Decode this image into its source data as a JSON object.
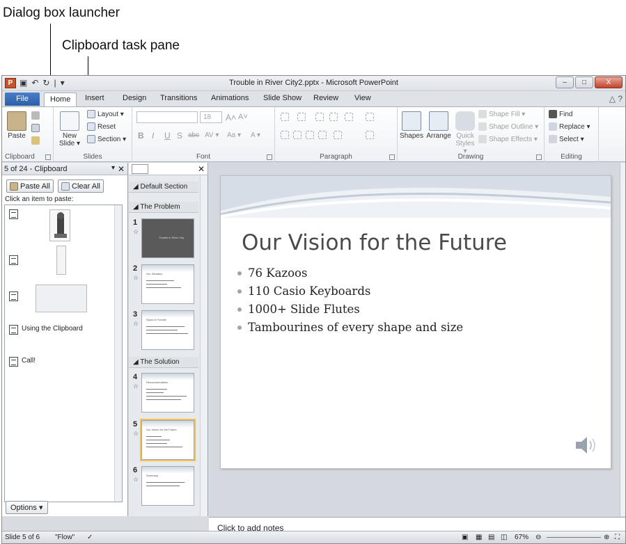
{
  "callouts": {
    "dialog_launcher": "Dialog box launcher",
    "clipboard_pane": "Clipboard task pane"
  },
  "window": {
    "title": "Trouble in River City2.pptx - Microsoft PowerPoint",
    "app_icon": "P",
    "qat": [
      "▣",
      "↶",
      "↻",
      "|",
      "▾"
    ],
    "min": "–",
    "max": "□",
    "close": "X"
  },
  "tabs": {
    "file": "File",
    "items": [
      "Home",
      "Insert",
      "Design",
      "Transitions",
      "Animations",
      "Slide Show",
      "Review",
      "View"
    ],
    "active": "Home",
    "help": "△ ?"
  },
  "ribbon": {
    "clipboard": {
      "label": "Clipboard",
      "paste": "Paste"
    },
    "slides": {
      "label": "Slides",
      "new_slide": "New",
      "new_slide_2": "Slide ▾",
      "layout": "Layout ▾",
      "reset": "Reset",
      "section": "Section ▾"
    },
    "font": {
      "label": "Font",
      "size": "18",
      "bold": "B",
      "italic": "I",
      "underline": "U",
      "shadow": "S",
      "strike": "abc",
      "spacing": "AV ▾",
      "case": "Aa ▾",
      "color": "A ▾",
      "grow": "A˄",
      "shrink": "A˅"
    },
    "paragraph": {
      "label": "Paragraph"
    },
    "drawing": {
      "label": "Drawing",
      "shapes": "Shapes",
      "arrange": "Arrange",
      "quick": "Quick",
      "quick_2": "Styles ▾",
      "fill": "Shape Fill ▾",
      "outline": "Shape Outline ▾",
      "effects": "Shape Effects ▾"
    },
    "editing": {
      "label": "Editing",
      "find": "Find",
      "replace": "Replace ▾",
      "select": "Select ▾"
    }
  },
  "clipboard_pane": {
    "title": "5 of 24 - Clipboard",
    "menu": "▾",
    "close": "✕",
    "paste_all": "Paste All",
    "clear_all": "Clear All",
    "hint": "Click an item to paste:",
    "items": [
      "Using the Clipboard",
      "Call!"
    ],
    "options": "Options ▾"
  },
  "slides_pane": {
    "close": "✕",
    "sections": [
      "Default Section",
      "The Problem",
      "The Solution"
    ],
    "thumbnails": [
      {
        "num": "1",
        "title": "Trouble in River City"
      },
      {
        "num": "2",
        "title": "Our Situation"
      },
      {
        "num": "3",
        "title": "Signs of Trouble"
      },
      {
        "num": "4",
        "title": "Recommendation"
      },
      {
        "num": "5",
        "title": "Our Vision for the Future"
      },
      {
        "num": "6",
        "title": "Summary"
      }
    ],
    "star": "☆"
  },
  "slide": {
    "title": "Our Vision for the Future",
    "bullets": [
      "76 Kazoos",
      "110 Casio Keyboards",
      "1000+ Slide Flutes",
      "Tambourines of every shape and size"
    ]
  },
  "notes": {
    "placeholder": "Click to add notes"
  },
  "status": {
    "slide": "Slide 5 of 6",
    "theme": "\"Flow\"",
    "zoom": "67%"
  },
  "colors": {
    "file_tab": "#2b5ea8",
    "bullet_dot": "#9aa5b3",
    "slide_title": "#4a4a4a"
  }
}
